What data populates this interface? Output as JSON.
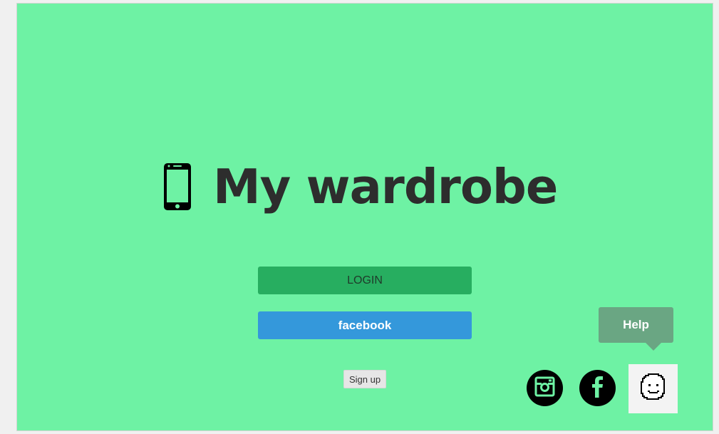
{
  "app": {
    "title": "My wardrobe"
  },
  "buttons": {
    "login_label": "LOGIN",
    "facebook_label": "facebook",
    "signup_label": "Sign up"
  },
  "help": {
    "label": "Help"
  },
  "social": {
    "instagram_icon": "instagram-icon",
    "facebook_icon": "facebook-icon",
    "help_avatar_icon": "smiley-face-icon"
  },
  "colors": {
    "background": "#6ef2a4",
    "login": "#27ae60",
    "facebook": "#3498db",
    "help_bubble": "#6aa683"
  }
}
